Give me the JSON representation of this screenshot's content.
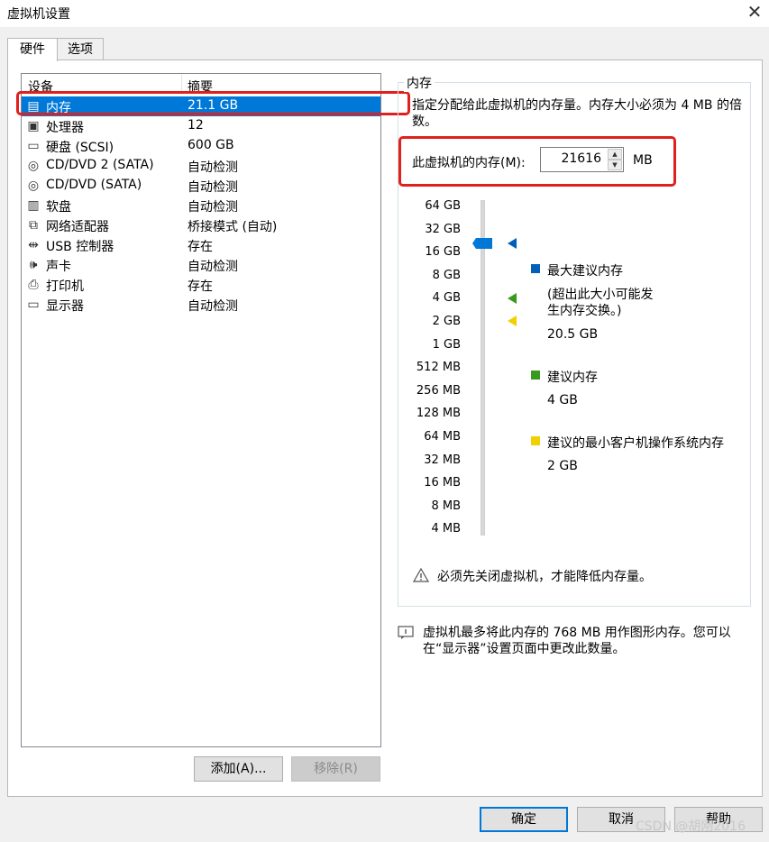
{
  "window": {
    "title": "虚拟机设置",
    "close_glyph": "✕"
  },
  "tabs": [
    {
      "label": "硬件",
      "active": true
    },
    {
      "label": "选项",
      "active": false
    }
  ],
  "device_list": {
    "headers": {
      "device": "设备",
      "summary": "摘要"
    },
    "rows": [
      {
        "icon": "memory-icon",
        "glyph": "▤",
        "name": "内存",
        "summary": "21.1 GB",
        "selected": true
      },
      {
        "icon": "processor-icon",
        "glyph": "▣",
        "name": "处理器",
        "summary": "12"
      },
      {
        "icon": "hard-disk-icon",
        "glyph": "▭",
        "name": "硬盘 (SCSI)",
        "summary": "600 GB"
      },
      {
        "icon": "cd-dvd-icon",
        "glyph": "◎",
        "name": "CD/DVD 2 (SATA)",
        "summary": "自动检测"
      },
      {
        "icon": "cd-dvd-icon",
        "glyph": "◎",
        "name": "CD/DVD (SATA)",
        "summary": "自动检测"
      },
      {
        "icon": "floppy-icon",
        "glyph": "▥",
        "name": "软盘",
        "summary": "自动检测"
      },
      {
        "icon": "network-adapter-icon",
        "glyph": "⧉",
        "name": "网络适配器",
        "summary": "桥接模式 (自动)"
      },
      {
        "icon": "usb-icon",
        "glyph": "⇹",
        "name": "USB 控制器",
        "summary": "存在"
      },
      {
        "icon": "sound-card-icon",
        "glyph": "🕪",
        "name": "声卡",
        "summary": "自动检测"
      },
      {
        "icon": "printer-icon",
        "glyph": "⎙",
        "name": "打印机",
        "summary": "存在"
      },
      {
        "icon": "display-icon",
        "glyph": "▭",
        "name": "显示器",
        "summary": "自动检测"
      }
    ],
    "add_button": "添加(A)...",
    "remove_button": "移除(R)"
  },
  "memory": {
    "group_title": "内存",
    "description": "指定分配给此虚拟机的内存量。内存大小必须为 4 MB 的倍数。",
    "field_label": "此虚拟机的内存(M):",
    "field_value": "21616",
    "unit": "MB",
    "scale": [
      "64 GB",
      "32 GB",
      "16 GB",
      "8 GB",
      "4 GB",
      "2 GB",
      "1 GB",
      "512 MB",
      "256 MB",
      "128 MB",
      "64 MB",
      "32 MB",
      "16 MB",
      "8 MB",
      "4 MB"
    ],
    "legend": {
      "max": {
        "title": "最大建议内存",
        "note": "(超出此大小可能发生内存交换。)",
        "value": "20.5 GB",
        "color": "#005fb8"
      },
      "recommended": {
        "title": "建议内存",
        "value": "4 GB",
        "color": "#3a9a1e"
      },
      "min_guest": {
        "title": "建议的最小客户机操作系统内存",
        "value": "2 GB",
        "color": "#f0d000"
      }
    },
    "warning": "必须先关闭虚拟机，才能降低内存量。",
    "info": "虚拟机最多将此内存的 768 MB 用作图形内存。您可以在“显示器”设置页面中更改此数量。"
  },
  "footer": {
    "ok": "确定",
    "cancel": "取消",
    "help": "帮助"
  },
  "watermark": "CSDN @胡刚2016"
}
